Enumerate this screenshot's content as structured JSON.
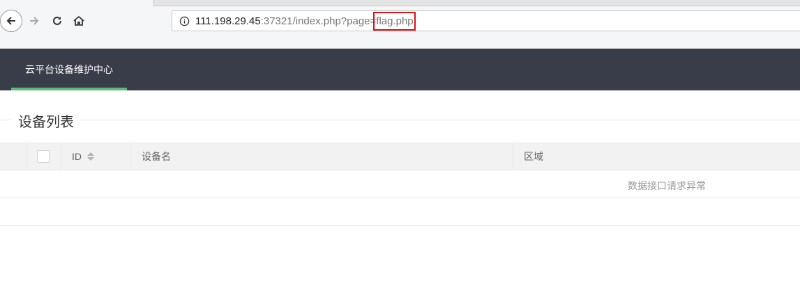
{
  "browser": {
    "url_host": "111.198.29.45",
    "url_rest": ":37321/index.php?page=flag.php",
    "nav_icons": [
      "back-arrow-icon",
      "forward-arrow-icon",
      "reload-icon",
      "home-icon",
      "info-icon"
    ]
  },
  "app": {
    "nav_title": "云平台设备维护中心",
    "accent_color": "#5fb878",
    "header_color": "#393d49"
  },
  "section": {
    "title": "设备列表"
  },
  "table": {
    "columns": {
      "id": "ID",
      "name": "设备名",
      "region": "区域"
    },
    "empty_message": "数据接口请求异常"
  }
}
